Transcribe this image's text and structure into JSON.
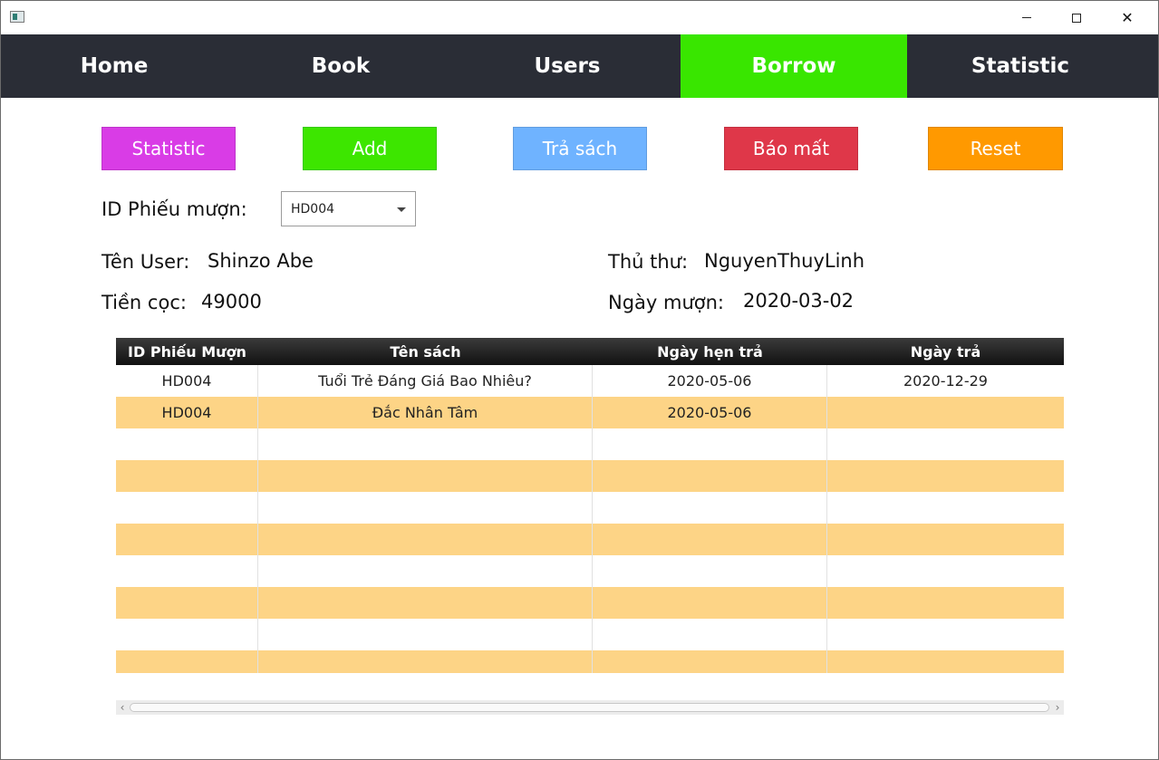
{
  "window": {
    "icons": {
      "app": "app-icon",
      "minimize": "minimize-icon",
      "maximize": "maximize-icon",
      "close": "close-icon"
    },
    "close_glyph": "✕"
  },
  "nav": {
    "tabs": [
      {
        "label": "Home",
        "active": false
      },
      {
        "label": "Book",
        "active": false
      },
      {
        "label": "Users",
        "active": false
      },
      {
        "label": "Borrow",
        "active": true
      },
      {
        "label": "Statistic",
        "active": false
      }
    ],
    "active_color": "#39e600",
    "bar_color": "#2a2d36"
  },
  "actions": [
    {
      "label": "Statistic",
      "color": "#d93ce6"
    },
    {
      "label": "Add",
      "color": "#3de600"
    },
    {
      "label": "Trả sách",
      "color": "#6fb3ff"
    },
    {
      "label": "Báo mất",
      "color": "#df3749"
    },
    {
      "label": "Reset",
      "color": "#ff9900"
    }
  ],
  "form": {
    "id_label": "ID Phiếu mượn:",
    "id_value": "HD004",
    "user_label": "Tên User:",
    "user_value": "Shinzo Abe",
    "deposit_label": "Tiền cọc:",
    "deposit_value": "49000",
    "librarian_label": "Thủ thư:",
    "librarian_value": "NguyenThuyLinh",
    "borrow_date_label": "Ngày mượn:",
    "borrow_date_value": "2020-03-02"
  },
  "table": {
    "columns": [
      "ID Phiếu Mượn",
      "Tên sách",
      "Ngày hẹn trả",
      "Ngày trả"
    ],
    "rows": [
      [
        "HD004",
        "Tuổi Trẻ Đáng Giá Bao Nhiêu?",
        "2020-05-06",
        "2020-12-29"
      ],
      [
        "HD004",
        "Đắc Nhân Tâm",
        "2020-05-06",
        ""
      ],
      [
        "",
        "",
        "",
        ""
      ],
      [
        "",
        "",
        "",
        ""
      ],
      [
        "",
        "",
        "",
        ""
      ],
      [
        "",
        "",
        "",
        ""
      ],
      [
        "",
        "",
        "",
        ""
      ],
      [
        "",
        "",
        "",
        ""
      ],
      [
        "",
        "",
        "",
        ""
      ],
      [
        "",
        "",
        "",
        ""
      ]
    ],
    "stripe_color": "#fdd486",
    "scroll_left": "‹",
    "scroll_right": "›"
  }
}
